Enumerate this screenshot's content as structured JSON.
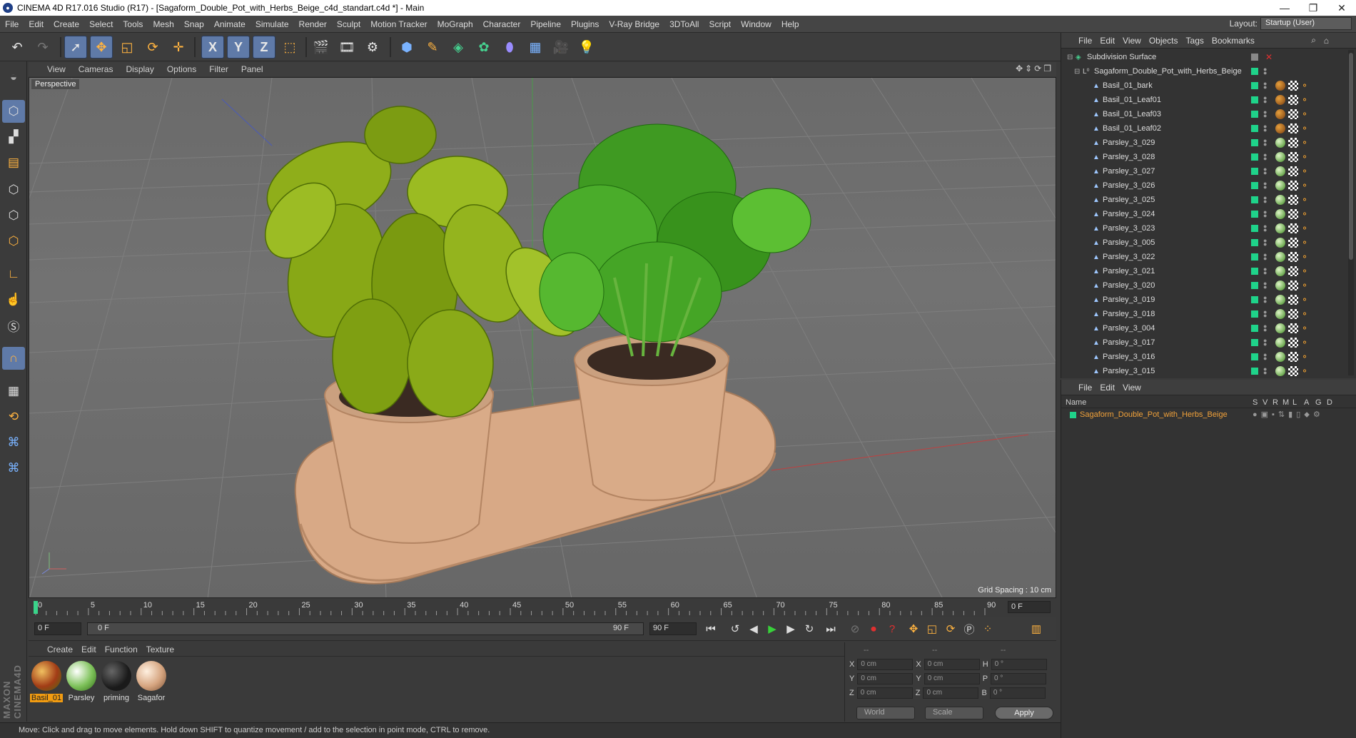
{
  "window": {
    "title": "CINEMA 4D R17.016 Studio (R17) - [Sagaform_Double_Pot_with_Herbs_Beige_c4d_standart.c4d *] - Main"
  },
  "menu": [
    "File",
    "Edit",
    "Create",
    "Select",
    "Tools",
    "Mesh",
    "Snap",
    "Animate",
    "Simulate",
    "Render",
    "Sculpt",
    "Motion Tracker",
    "MoGraph",
    "Character",
    "Pipeline",
    "Plugins",
    "V-Ray Bridge",
    "3DToAll",
    "Script",
    "Window",
    "Help"
  ],
  "layout": {
    "label": "Layout:",
    "value": "Startup (User)"
  },
  "toolbar": {
    "x_label": "X",
    "y_label": "Y",
    "z_label": "Z"
  },
  "viewport": {
    "menu": [
      "View",
      "Cameras",
      "Display",
      "Options",
      "Filter",
      "Panel"
    ],
    "label": "Perspective",
    "grid_spacing": "Grid Spacing : 10 cm"
  },
  "timeline": {
    "ticks": [
      "0",
      "5",
      "10",
      "15",
      "20",
      "25",
      "30",
      "35",
      "40",
      "45",
      "50",
      "55",
      "60",
      "65",
      "70",
      "75",
      "80",
      "85",
      "90"
    ],
    "current": 0,
    "end_field": "0 F"
  },
  "transport": {
    "start": "0 F",
    "range_start": "0 F",
    "range_end": "90 F",
    "end": "90 F"
  },
  "materials": {
    "menu": [
      "Create",
      "Edit",
      "Function",
      "Texture"
    ],
    "items": [
      {
        "name": "Basil_01",
        "selected": true
      },
      {
        "name": "Parsley",
        "selected": false
      },
      {
        "name": "priming",
        "selected": false
      },
      {
        "name": "Sagafor",
        "selected": false
      }
    ]
  },
  "coords": {
    "header": [
      "--",
      "--",
      "--"
    ],
    "rows": [
      {
        "a": "X",
        "av": "0 cm",
        "b": "X",
        "bv": "0 cm",
        "c": "H",
        "cv": "0 °"
      },
      {
        "a": "Y",
        "av": "0 cm",
        "b": "Y",
        "bv": "0 cm",
        "c": "P",
        "cv": "0 °"
      },
      {
        "a": "Z",
        "av": "0 cm",
        "b": "Z",
        "bv": "0 cm",
        "c": "B",
        "cv": "0 °"
      }
    ],
    "world": "World",
    "scale": "Scale",
    "apply": "Apply"
  },
  "status": "Move: Click and drag to move elements. Hold down SHIFT to quantize movement / add to the selection in point mode, CTRL to remove.",
  "objects": {
    "menu": [
      "File",
      "Edit",
      "View",
      "Objects",
      "Tags",
      "Bookmarks"
    ],
    "root": "Subdivision Surface",
    "group": "Sagaform_Double_Pot_with_Herbs_Beige",
    "items": [
      {
        "name": "Basil_01_bark",
        "mat": "basil"
      },
      {
        "name": "Basil_01_Leaf01",
        "mat": "basil"
      },
      {
        "name": "Basil_01_Leaf03",
        "mat": "basil"
      },
      {
        "name": "Basil_01_Leaf02",
        "mat": "basil"
      },
      {
        "name": "Parsley_3_029",
        "mat": "pars"
      },
      {
        "name": "Parsley_3_028",
        "mat": "pars"
      },
      {
        "name": "Parsley_3_027",
        "mat": "pars"
      },
      {
        "name": "Parsley_3_026",
        "mat": "pars"
      },
      {
        "name": "Parsley_3_025",
        "mat": "pars"
      },
      {
        "name": "Parsley_3_024",
        "mat": "pars"
      },
      {
        "name": "Parsley_3_023",
        "mat": "pars"
      },
      {
        "name": "Parsley_3_005",
        "mat": "pars"
      },
      {
        "name": "Parsley_3_022",
        "mat": "pars"
      },
      {
        "name": "Parsley_3_021",
        "mat": "pars"
      },
      {
        "name": "Parsley_3_020",
        "mat": "pars"
      },
      {
        "name": "Parsley_3_019",
        "mat": "pars"
      },
      {
        "name": "Parsley_3_018",
        "mat": "pars"
      },
      {
        "name": "Parsley_3_004",
        "mat": "pars"
      },
      {
        "name": "Parsley_3_017",
        "mat": "pars"
      },
      {
        "name": "Parsley_3_016",
        "mat": "pars"
      },
      {
        "name": "Parsley_3_015",
        "mat": "pars"
      }
    ]
  },
  "attributes": {
    "menu": [
      "File",
      "Edit",
      "View"
    ],
    "columns": [
      "Name",
      "S",
      "V",
      "R",
      "M",
      "L",
      "A",
      "G",
      "D"
    ],
    "row": "Sagaform_Double_Pot_with_Herbs_Beige"
  }
}
